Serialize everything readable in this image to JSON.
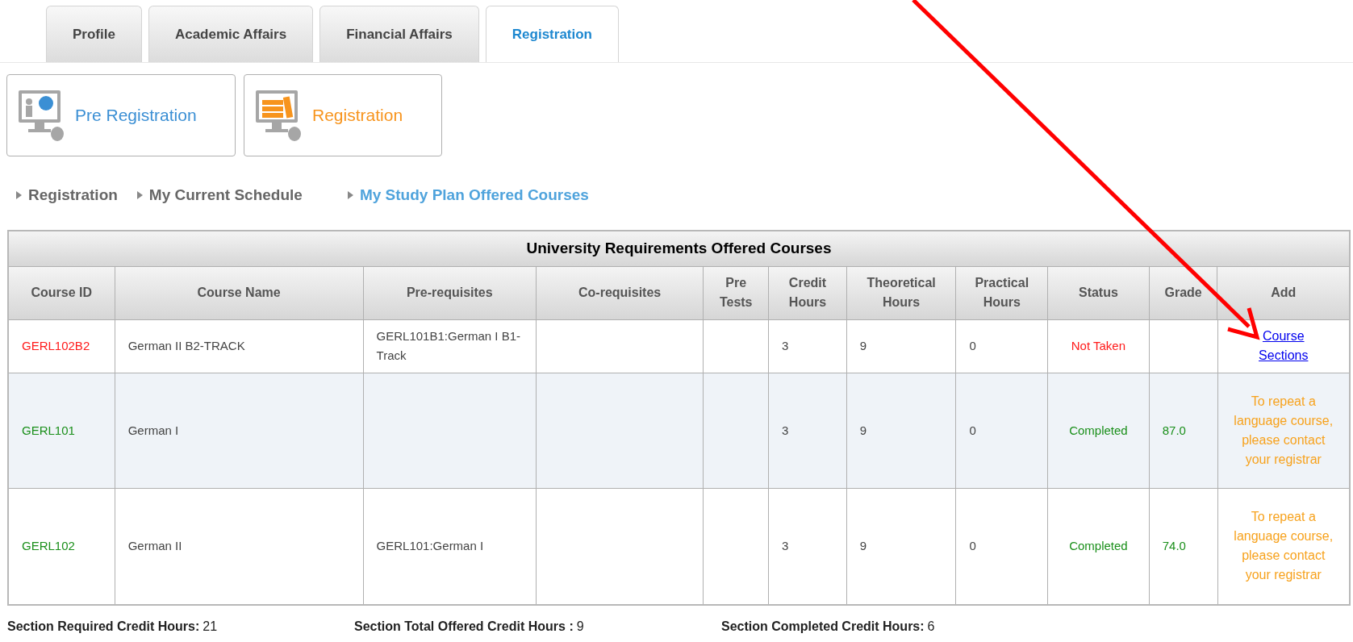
{
  "tabs": [
    {
      "label": "Profile",
      "selected": false
    },
    {
      "label": "Academic Affairs",
      "selected": false
    },
    {
      "label": "Financial Affairs",
      "selected": false
    },
    {
      "label": "Registration",
      "selected": true
    }
  ],
  "modules": [
    {
      "label": "Pre Registration",
      "kind": "presentation",
      "color": "#3b8fd4"
    },
    {
      "label": "Registration",
      "kind": "books",
      "color": "#f7941d"
    }
  ],
  "breadcrumbs": [
    {
      "label": "Registration",
      "selected": false
    },
    {
      "label": "My Current Schedule",
      "selected": false
    },
    {
      "label": "My Study Plan Offered Courses",
      "selected": true
    }
  ],
  "table": {
    "title": "University Requirements Offered Courses",
    "columns": [
      "Course ID",
      "Course Name",
      "Pre-requisites",
      "Co-requisites",
      "Pre Tests",
      "Credit Hours",
      "Theoretical Hours",
      "Practical Hours",
      "Status",
      "Grade",
      "Add"
    ],
    "rows": [
      {
        "course_id": "GERL102B2",
        "course_name": "German II B2-TRACK",
        "prerequisites": "GERL101B1:German I B1- Track",
        "corequisites": "",
        "pre_tests": "",
        "credit_hours": "3",
        "theoretical_hours": "9",
        "practical_hours": "0",
        "status": "Not Taken",
        "color": "#ff1a1a",
        "grade": "",
        "add": {
          "kind": "link",
          "text": "Course Sections"
        }
      },
      {
        "course_id": "GERL101",
        "course_name": "German I",
        "prerequisites": "",
        "corequisites": "",
        "pre_tests": "",
        "credit_hours": "3",
        "theoretical_hours": "9",
        "practical_hours": "0",
        "status": "Completed",
        "color": "#1a8f1a",
        "grade": "87.0",
        "add": {
          "kind": "note",
          "text": "To repeat a language course, please contact your registrar"
        }
      },
      {
        "course_id": "GERL102",
        "course_name": "German II",
        "prerequisites": "GERL101:German I",
        "corequisites": "",
        "pre_tests": "",
        "credit_hours": "3",
        "theoretical_hours": "9",
        "practical_hours": "0",
        "status": "Completed",
        "color": "#1a8f1a",
        "grade": "74.0",
        "add": {
          "kind": "note",
          "text": "To repeat a language course, please contact your registrar"
        }
      }
    ]
  },
  "summary": [
    {
      "label": "Section Required Credit Hours:",
      "value": "21"
    },
    {
      "label": "Section Total Offered Credit Hours :",
      "value": "9"
    },
    {
      "label": "Section Completed Credit Hours:",
      "value": "6"
    }
  ]
}
